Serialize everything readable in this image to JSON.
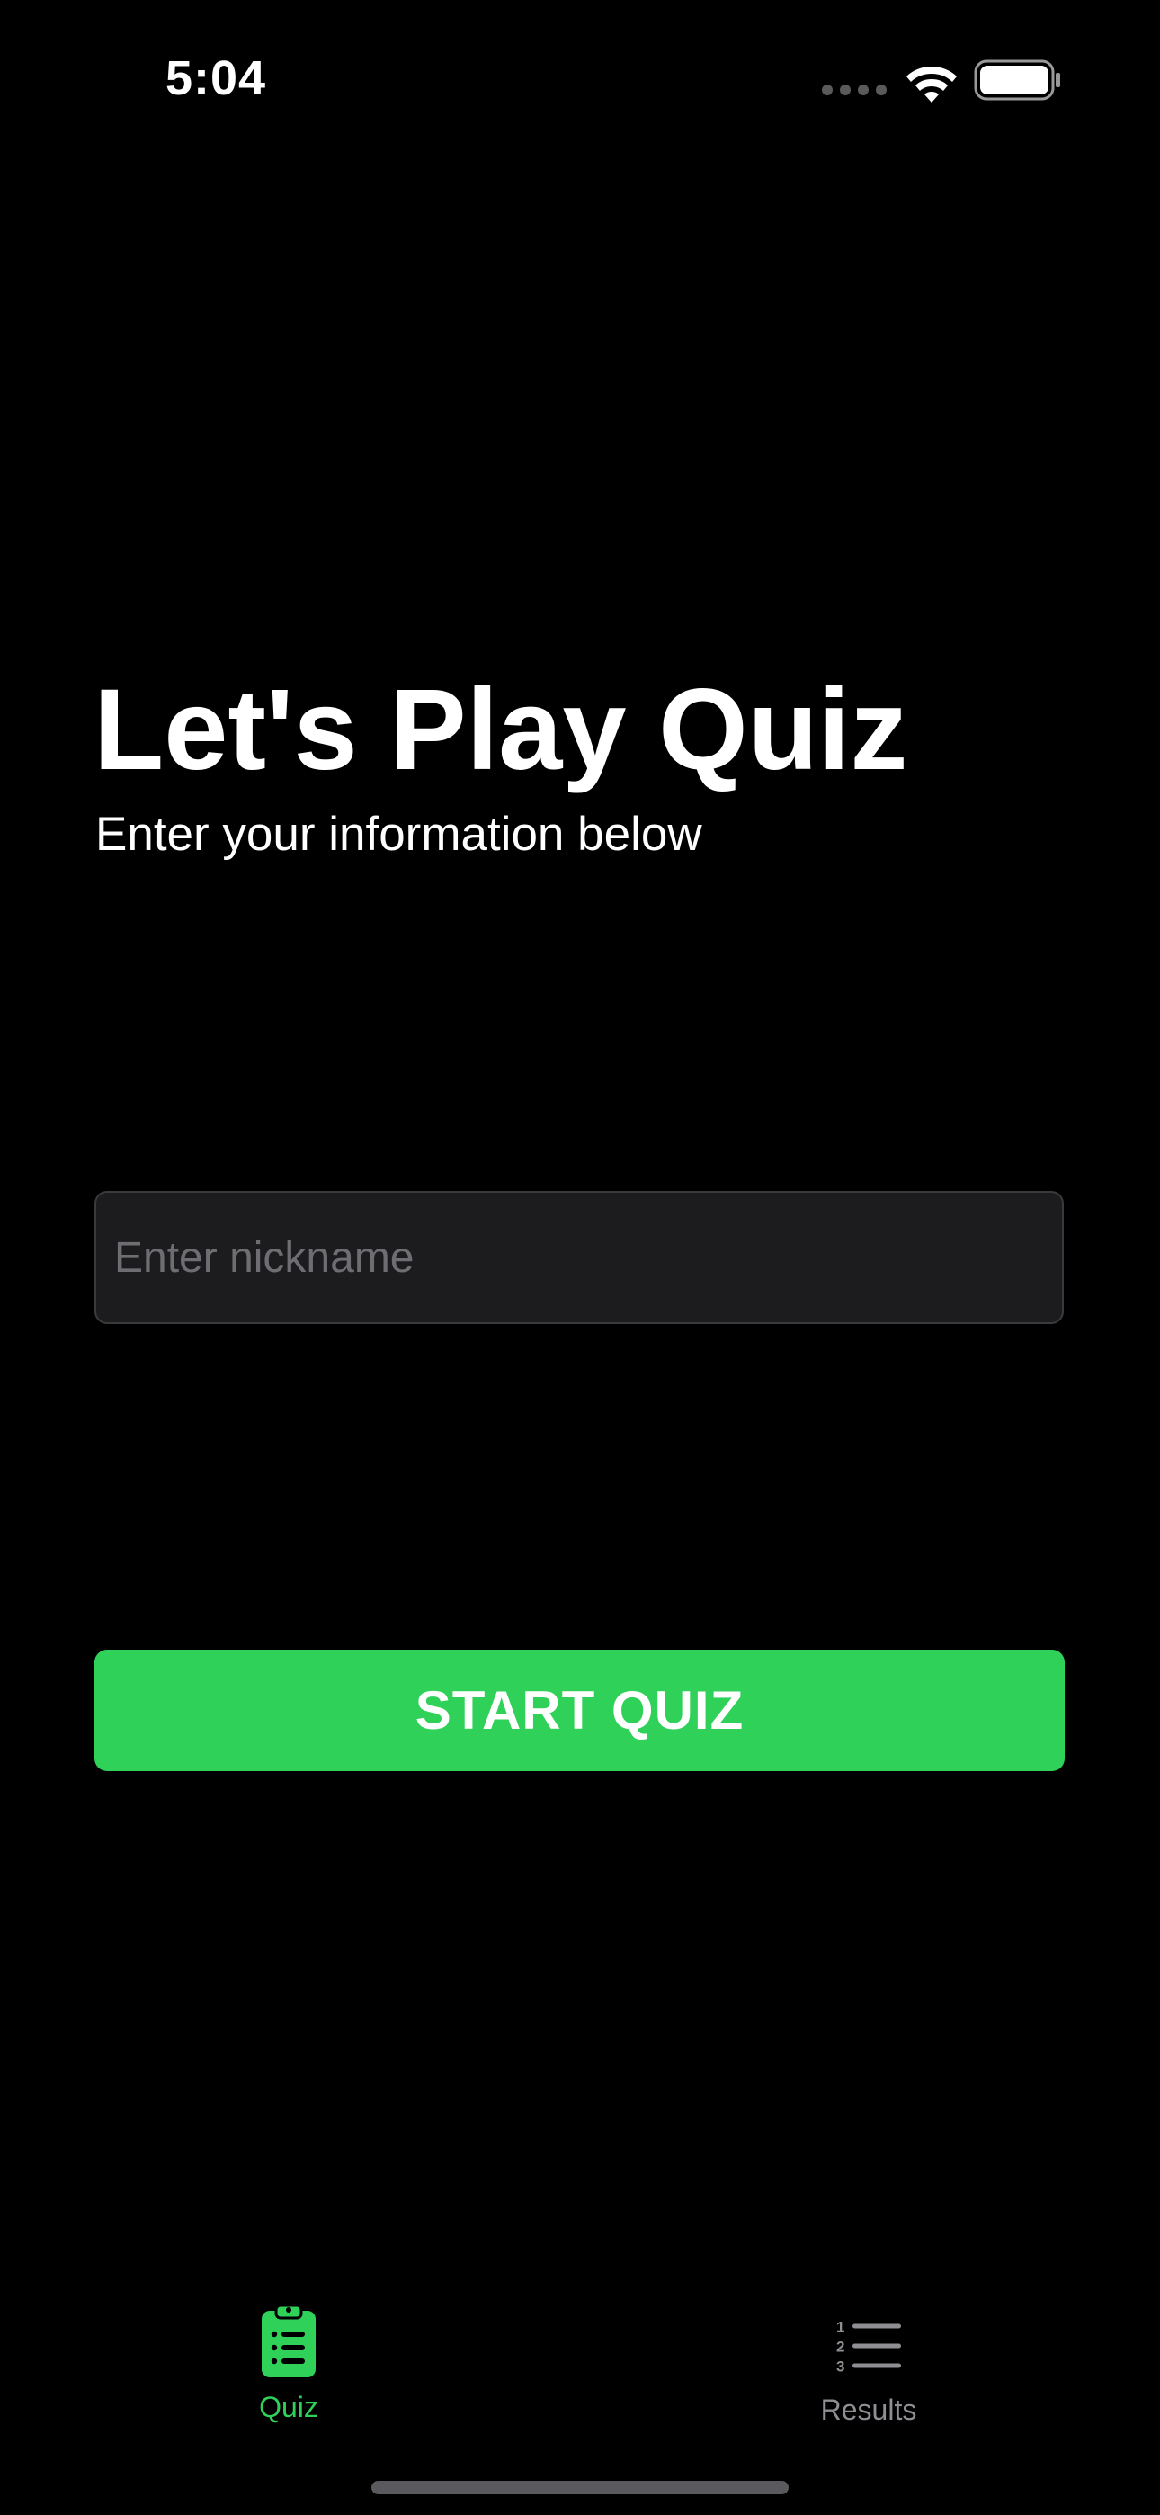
{
  "status_bar": {
    "time": "5:04",
    "icons": [
      "cellular-signal-icon",
      "wifi-icon",
      "battery-icon"
    ]
  },
  "header": {
    "title": "Let's Play Quiz",
    "subtitle": "Enter your information below"
  },
  "form": {
    "nickname_placeholder": "Enter nickname",
    "nickname_value": ""
  },
  "actions": {
    "start_label": "START QUIZ"
  },
  "tab_bar": {
    "selected": "quiz",
    "items": [
      {
        "id": "quiz",
        "label": "Quiz",
        "icon": "clipboard-list-icon"
      },
      {
        "id": "results",
        "label": "Results",
        "icon": "numbered-list-icon"
      }
    ]
  },
  "colors": {
    "background": "#000000",
    "accent": "#30d158",
    "field_background": "#1c1c1e",
    "placeholder": "#6e6e72",
    "inactive_tab": "#8e8e93"
  }
}
